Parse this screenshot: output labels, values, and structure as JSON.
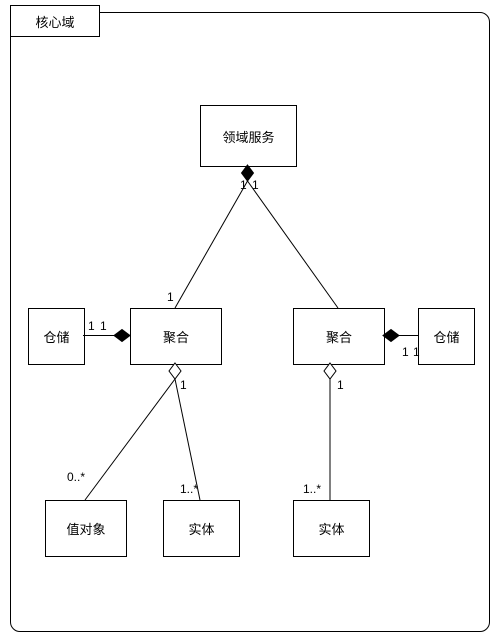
{
  "frame": {
    "title": "核心域"
  },
  "boxes": {
    "domainService": "领域服务",
    "aggregateLeft": "聚合",
    "aggregateRight": "聚合",
    "repositoryLeft": "仓储",
    "repositoryRight": "仓储",
    "valueObject": "值对象",
    "entityLeft": "实体",
    "entityRight": "实体"
  },
  "multiplicities": {
    "ds_to_aggL_top": "1",
    "ds_to_aggL_bottom": "1",
    "ds_to_aggR_top": "1",
    "aggL_repoL_left": "1",
    "aggL_repoL_right": "1",
    "aggR_repoR_left": "1",
    "aggR_repoR_right": "1",
    "aggL_children_top": "1",
    "aggR_children_top": "1",
    "valueObject_m": "0..*",
    "entityLeft_m": "1..*",
    "entityRight_m": "1..*"
  }
}
